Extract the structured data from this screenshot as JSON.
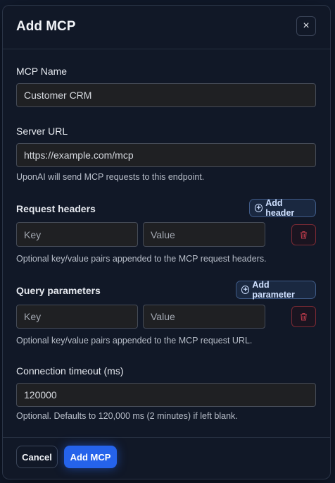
{
  "dialog": {
    "title": "Add MCP",
    "close_icon": "×"
  },
  "fields": {
    "name_label": "MCP Name",
    "name_value": "Customer CRM",
    "url_label": "Server URL",
    "url_value": "https://example.com/mcp",
    "url_hint": "UponAI will send MCP requests to this endpoint."
  },
  "headers": {
    "label": "Request headers",
    "add_label": "Add header",
    "key_placeholder": "Key",
    "value_placeholder": "Value",
    "hint": "Optional key/value pairs appended to the MCP request headers."
  },
  "params": {
    "label": "Query parameters",
    "add_label": "Add parameter",
    "key_placeholder": "Key",
    "value_placeholder": "Value",
    "hint": "Optional key/value pairs appended to the MCP request URL."
  },
  "timeout": {
    "label": "Connection timeout (ms)",
    "value": "120000",
    "hint": "Optional. Defaults to 120,000 ms (2 minutes) if left blank."
  },
  "footer": {
    "cancel_label": "Cancel",
    "submit_label": "Add MCP"
  },
  "colors": {
    "accent": "#2563eb",
    "danger": "#b83a4a"
  }
}
